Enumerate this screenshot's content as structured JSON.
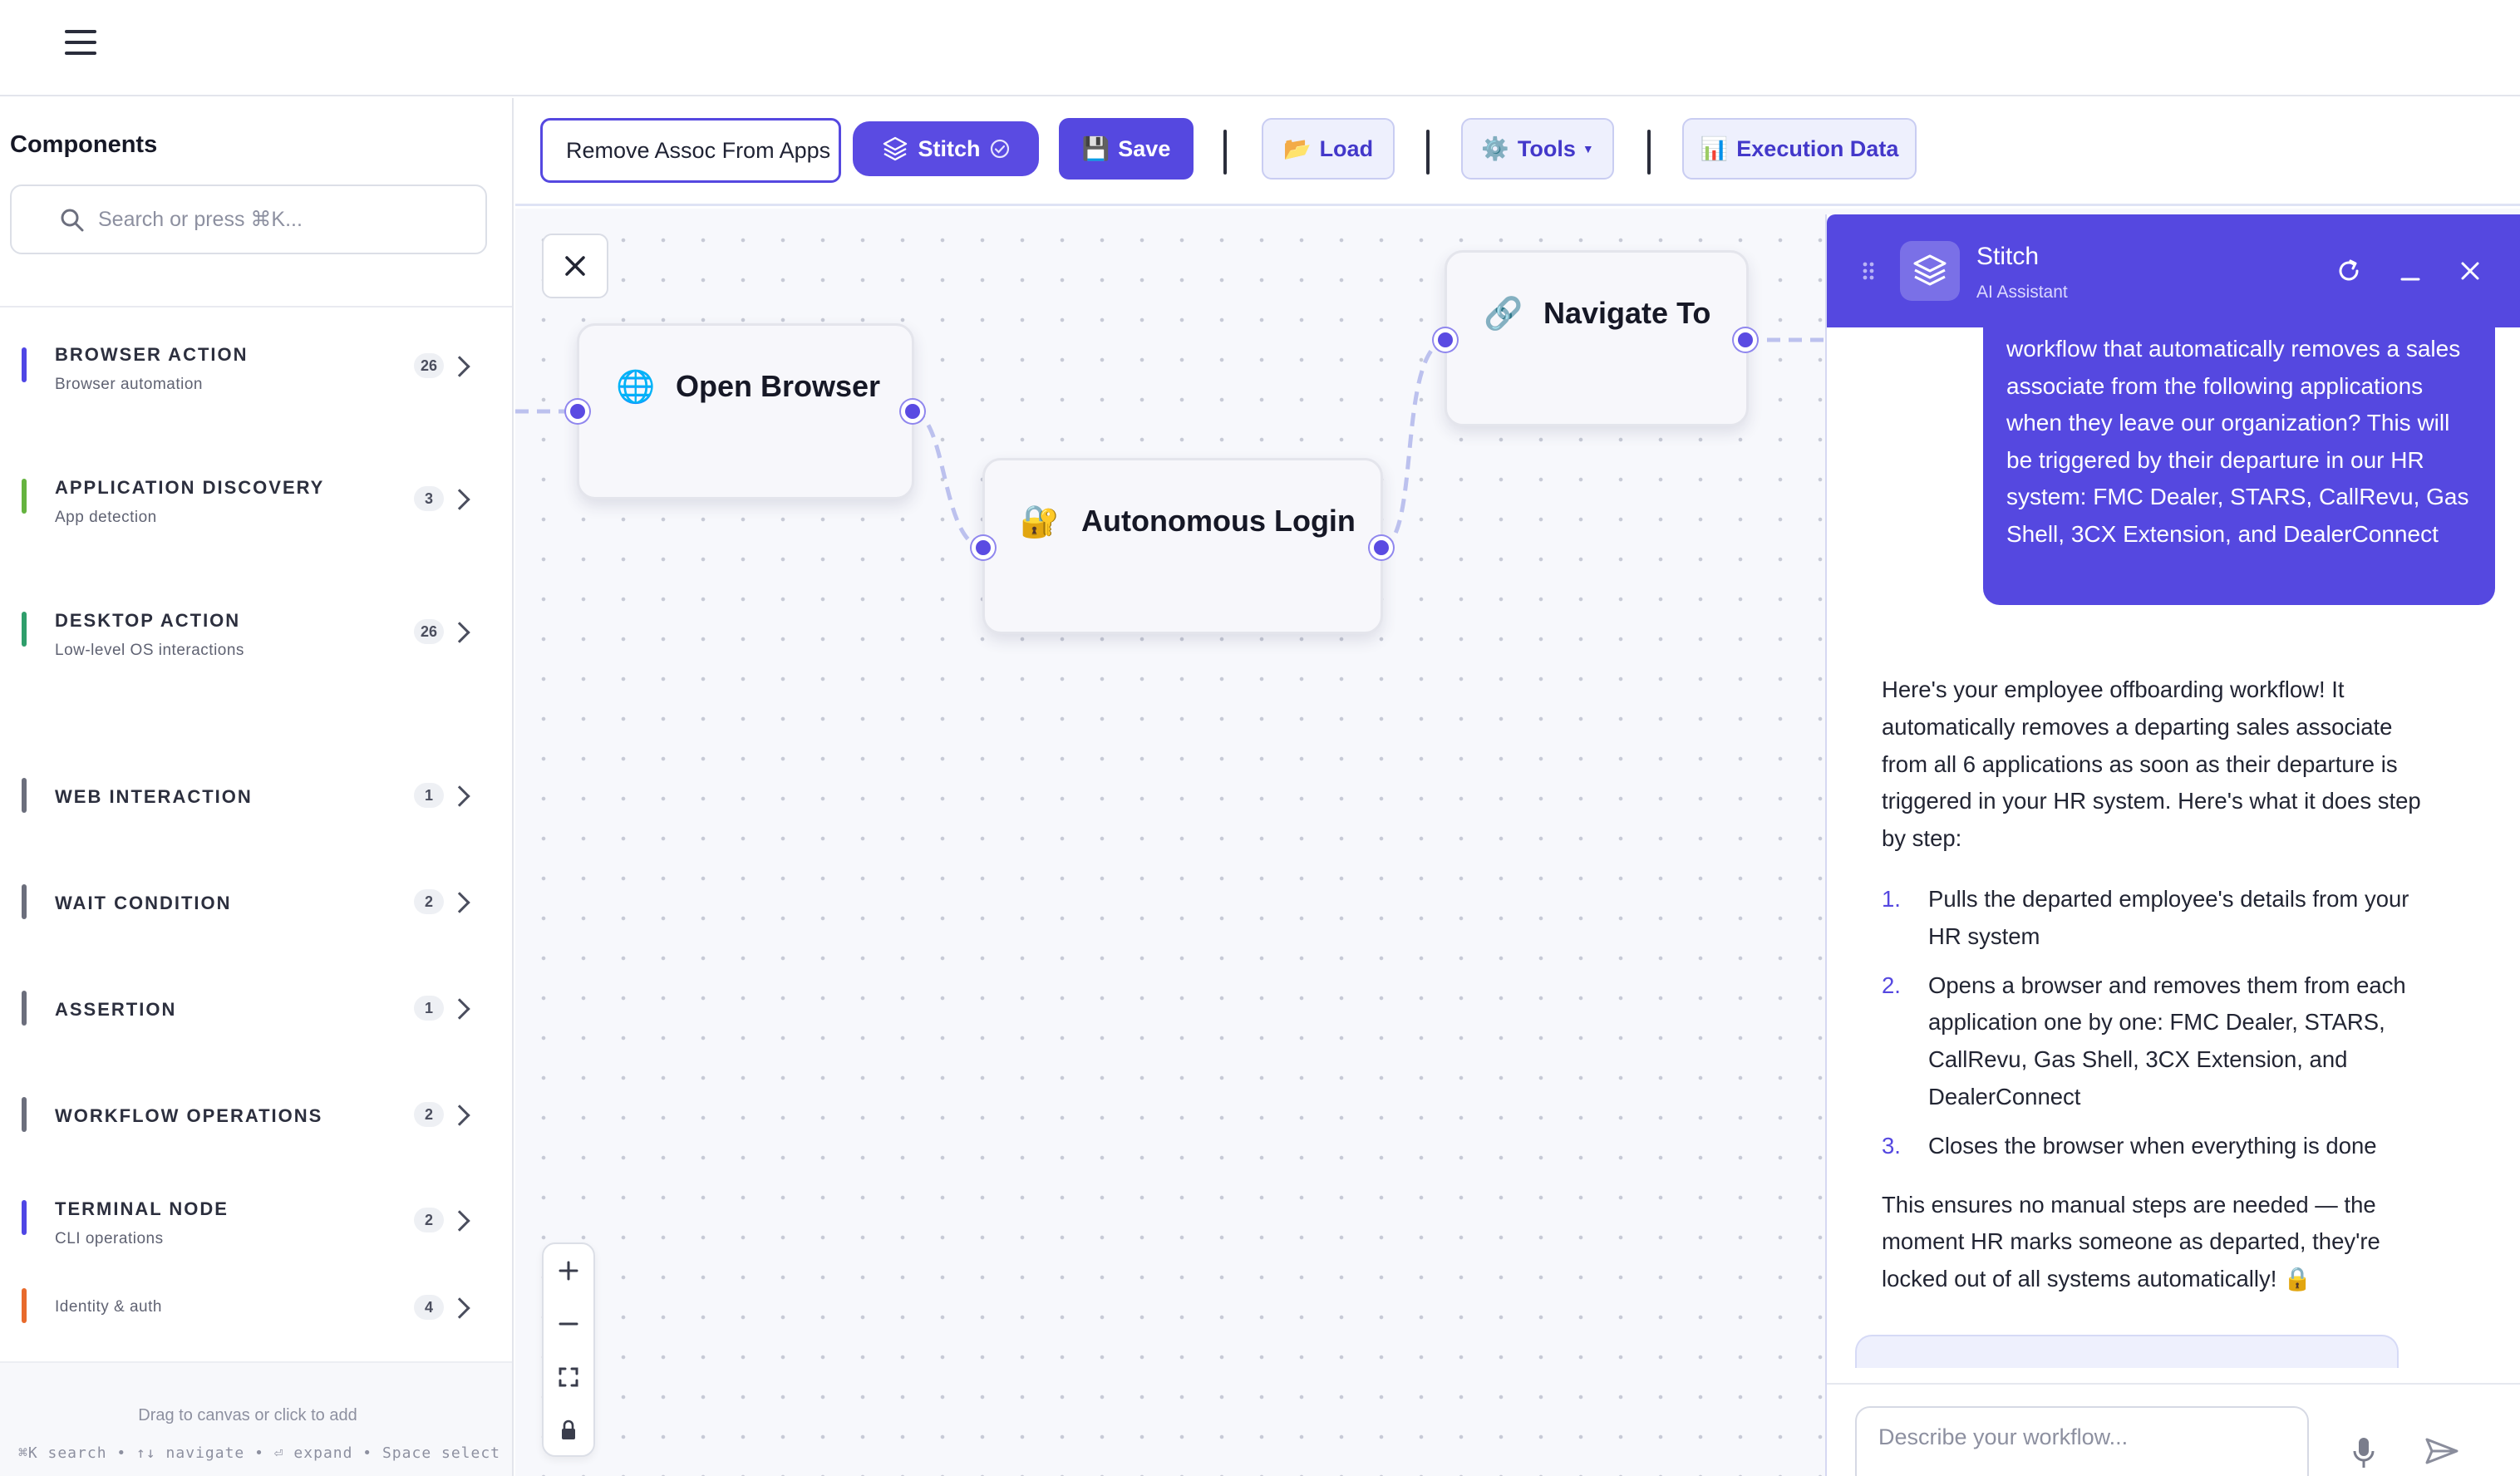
{
  "sidebar": {
    "title": "Components",
    "search_placeholder": "Search or press ⌘K...",
    "categories": [
      {
        "name": "BROWSER ACTION",
        "sub": "Browser automation",
        "count": "26",
        "color": "#4f46e5"
      },
      {
        "name": "APPLICATION DISCOVERY",
        "sub": "App detection",
        "count": "3",
        "color": "#65b33f"
      },
      {
        "name": "DESKTOP ACTION",
        "sub": "Low-level OS interactions",
        "count": "26",
        "color": "#2f9e6b"
      },
      {
        "name": "WEB INTERACTION",
        "sub": "",
        "count": "1",
        "color": "#6b6e7c"
      },
      {
        "name": "WAIT CONDITION",
        "sub": "",
        "count": "2",
        "color": "#6b6e7c"
      },
      {
        "name": "ASSERTION",
        "sub": "",
        "count": "1",
        "color": "#6b6e7c"
      },
      {
        "name": "WORKFLOW OPERATIONS",
        "sub": "",
        "count": "2",
        "color": "#6b6e7c"
      },
      {
        "name": "TERMINAL NODE",
        "sub": "CLI operations",
        "count": "2",
        "color": "#4f46e5"
      },
      {
        "name": "",
        "sub": "Identity & auth",
        "count": "4",
        "color": "#e86a2c"
      }
    ],
    "footer_hint": "Drag to canvas or click to add",
    "footer_shortcuts": "⌘K search • ↑↓ navigate • ⏎ expand • Space select"
  },
  "toolbar": {
    "workflow_name": "Remove Assoc From Apps",
    "stitch_label": "Stitch",
    "save_label": "Save",
    "load_label": "Load",
    "tools_label": "Tools",
    "exec_label": "Execution Data",
    "save_icon": "💾",
    "load_icon": "📂",
    "tools_icon": "⚙️",
    "exec_icon": "📊"
  },
  "canvas": {
    "nodes": [
      {
        "label": "Open Browser",
        "icon": "🌐"
      },
      {
        "label": "Autonomous Login",
        "icon": "🔐"
      },
      {
        "label": "Navigate To",
        "icon": "🔗"
      }
    ]
  },
  "assistant": {
    "title": "Stitch",
    "subtitle": "AI Assistant",
    "user_message": "workflow that automatically removes a sales associate from the following applications when they leave our organization? This will be triggered by their departure in our HR system: FMC Dealer, STARS, CallRevu, Gas Shell, 3CX Extension, and DealerConnect",
    "reply_intro": "Here's your employee offboarding workflow! It automatically removes a departing sales associate from all 6 applications as soon as their departure is triggered in your HR system. Here's what it does step by step:",
    "steps": [
      {
        "num": "1.",
        "text": "Pulls the departed employee's details from your HR system"
      },
      {
        "num": "2.",
        "text": "Opens a browser and removes them from each application one by one: FMC Dealer, STARS, CallRevu, Gas Shell, 3CX Extension, and DealerConnect"
      },
      {
        "num": "3.",
        "text": "Closes the browser when everything is done"
      }
    ],
    "reply_outro": "This ensures no manual steps are needed — the moment HR marks someone as departed, they're locked out of all systems automatically! 🔒",
    "input_placeholder": "Describe your workflow...",
    "accent": "#5548e0"
  }
}
